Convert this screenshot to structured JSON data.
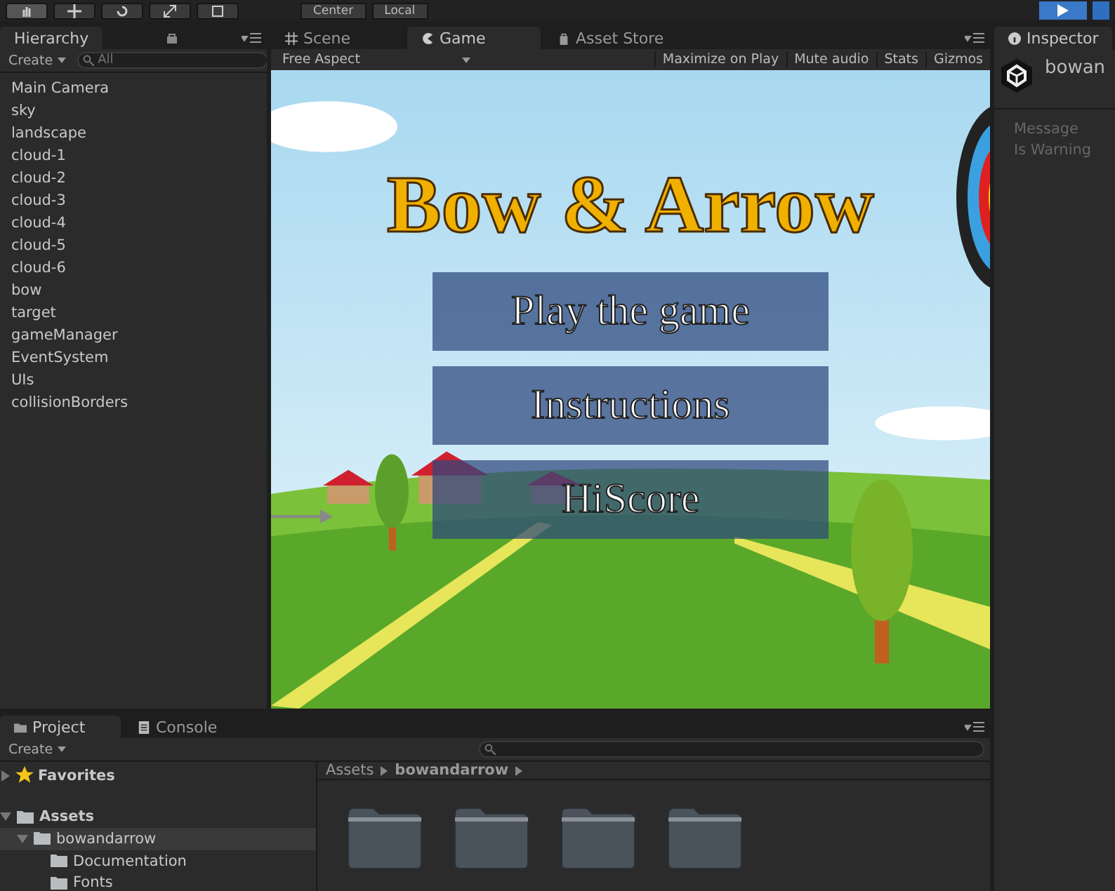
{
  "toolbar": {
    "pivot_buttons": [
      "Center",
      "Local"
    ]
  },
  "hierarchy": {
    "tab": "Hierarchy",
    "create": "Create",
    "search_placeholder": "All",
    "items": [
      {
        "label": "Main Camera",
        "selected": false
      },
      {
        "label": "sky",
        "selected": false
      },
      {
        "label": "landscape",
        "selected": false
      },
      {
        "label": "cloud-1",
        "selected": false
      },
      {
        "label": "cloud-2",
        "selected": false
      },
      {
        "label": "cloud-3",
        "selected": false
      },
      {
        "label": "cloud-4",
        "selected": false
      },
      {
        "label": "cloud-5",
        "selected": false
      },
      {
        "label": "cloud-6",
        "selected": false
      },
      {
        "label": "bow",
        "selected": false
      },
      {
        "label": "target",
        "selected": false
      },
      {
        "label": "gameManager",
        "selected": false
      },
      {
        "label": "EventSystem",
        "selected": false
      },
      {
        "label": "UIs",
        "selected": false
      },
      {
        "label": "collisionBorders",
        "selected": false
      }
    ]
  },
  "center_tabs": [
    {
      "label": "Scene",
      "kind": "scene",
      "selected": false
    },
    {
      "label": "Game",
      "kind": "game",
      "selected": true
    },
    {
      "label": "Asset Store",
      "kind": "store",
      "selected": false
    }
  ],
  "game_toolbar": {
    "aspect": "Free Aspect",
    "buttons": [
      "Maximize on Play",
      "Mute audio",
      "Stats",
      "Gizmos"
    ]
  },
  "game_view": {
    "title": "Bow & Arrow",
    "menu_buttons": [
      "Play the game",
      "Instructions",
      "HiScore"
    ]
  },
  "inspector": {
    "tab": "Inspector",
    "object_name": "bowan",
    "fields": [
      "Message",
      "Is Warning"
    ]
  },
  "project": {
    "tabs": [
      {
        "label": "Project",
        "selected": true
      },
      {
        "label": "Console",
        "selected": false
      }
    ],
    "create": "Create",
    "favorites": {
      "label": "Favorites",
      "expanded": false
    },
    "tree": [
      {
        "label": "Assets",
        "expanded": true,
        "selected": false,
        "children": [
          {
            "label": "bowandarrow",
            "expanded": true,
            "selected": true,
            "children": [
              {
                "label": "Documentation",
                "selected": false
              },
              {
                "label": "Fonts",
                "selected": false
              }
            ]
          }
        ]
      }
    ],
    "breadcrumb": [
      "Assets",
      "bowandarrow"
    ]
  }
}
